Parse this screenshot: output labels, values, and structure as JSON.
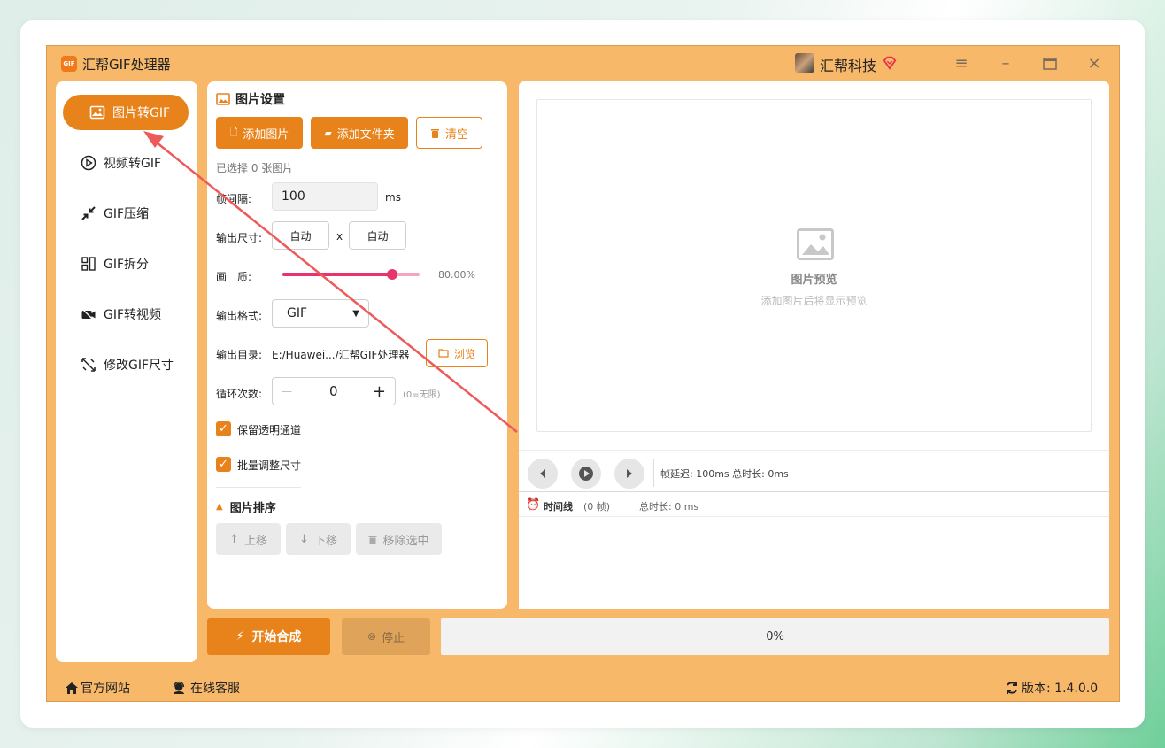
{
  "app": {
    "title": "汇帮GIF处理器",
    "logo_text": "GIF",
    "brand": "汇帮科技"
  },
  "nav": {
    "items": [
      {
        "label": "图片转GIF",
        "icon": "image-icon",
        "active": true
      },
      {
        "label": "视频转GIF",
        "icon": "play-circle-icon"
      },
      {
        "label": "GIF压缩",
        "icon": "compress-icon"
      },
      {
        "label": "GIF拆分",
        "icon": "split-icon"
      },
      {
        "label": "GIF转视频",
        "icon": "video-icon"
      },
      {
        "label": "修改GIF尺寸",
        "icon": "resize-icon"
      }
    ]
  },
  "settings": {
    "title": "图片设置",
    "add_image": "添加图片",
    "add_folder": "添加文件夹",
    "clear": "清空",
    "selected_count": "已选择 0 张图片",
    "frame_interval_label": "帧间隔:",
    "frame_interval_value": "100",
    "frame_interval_unit": "ms",
    "output_size_label": "输出尺寸:",
    "width_value": "自动",
    "size_sep": "x",
    "height_value": "自动",
    "quality_label": "画　质:",
    "quality_value": "80.00%",
    "quality_fraction": 0.8,
    "format_label": "输出格式:",
    "format_value": "GIF",
    "output_dir_label": "输出目录:",
    "output_dir_value": "E:/Huawei.../汇帮GIF处理器",
    "browse": "浏览",
    "loop_label": "循环次数:",
    "loop_value": "0",
    "loop_minus": "—",
    "loop_plus": "+",
    "loop_hint": "(0=无限)",
    "keep_alpha": "保留透明通道",
    "batch_resize": "批量调整尺寸",
    "sort_title": "图片排序",
    "move_up": "上移",
    "move_down": "下移",
    "remove_selected": "移除选中"
  },
  "preview": {
    "title": "图片预览",
    "hint": "添加图片后将显示预览",
    "status": "帧延迟: 100ms  总时长: 0ms",
    "timeline_label": "时间线",
    "timeline_count": "(0 帧)",
    "timeline_total": "总时长: 0 ms"
  },
  "actions": {
    "start": "开始合成",
    "stop": "停止",
    "progress": "0%"
  },
  "footer": {
    "website": "官方网站",
    "support": "在线客服",
    "version": "版本: 1.4.0.0"
  },
  "colors": {
    "accent": "#e8821a",
    "app_bg": "#f7b86a",
    "slider": "#e8336d",
    "arrow": "#ee5a5a"
  }
}
